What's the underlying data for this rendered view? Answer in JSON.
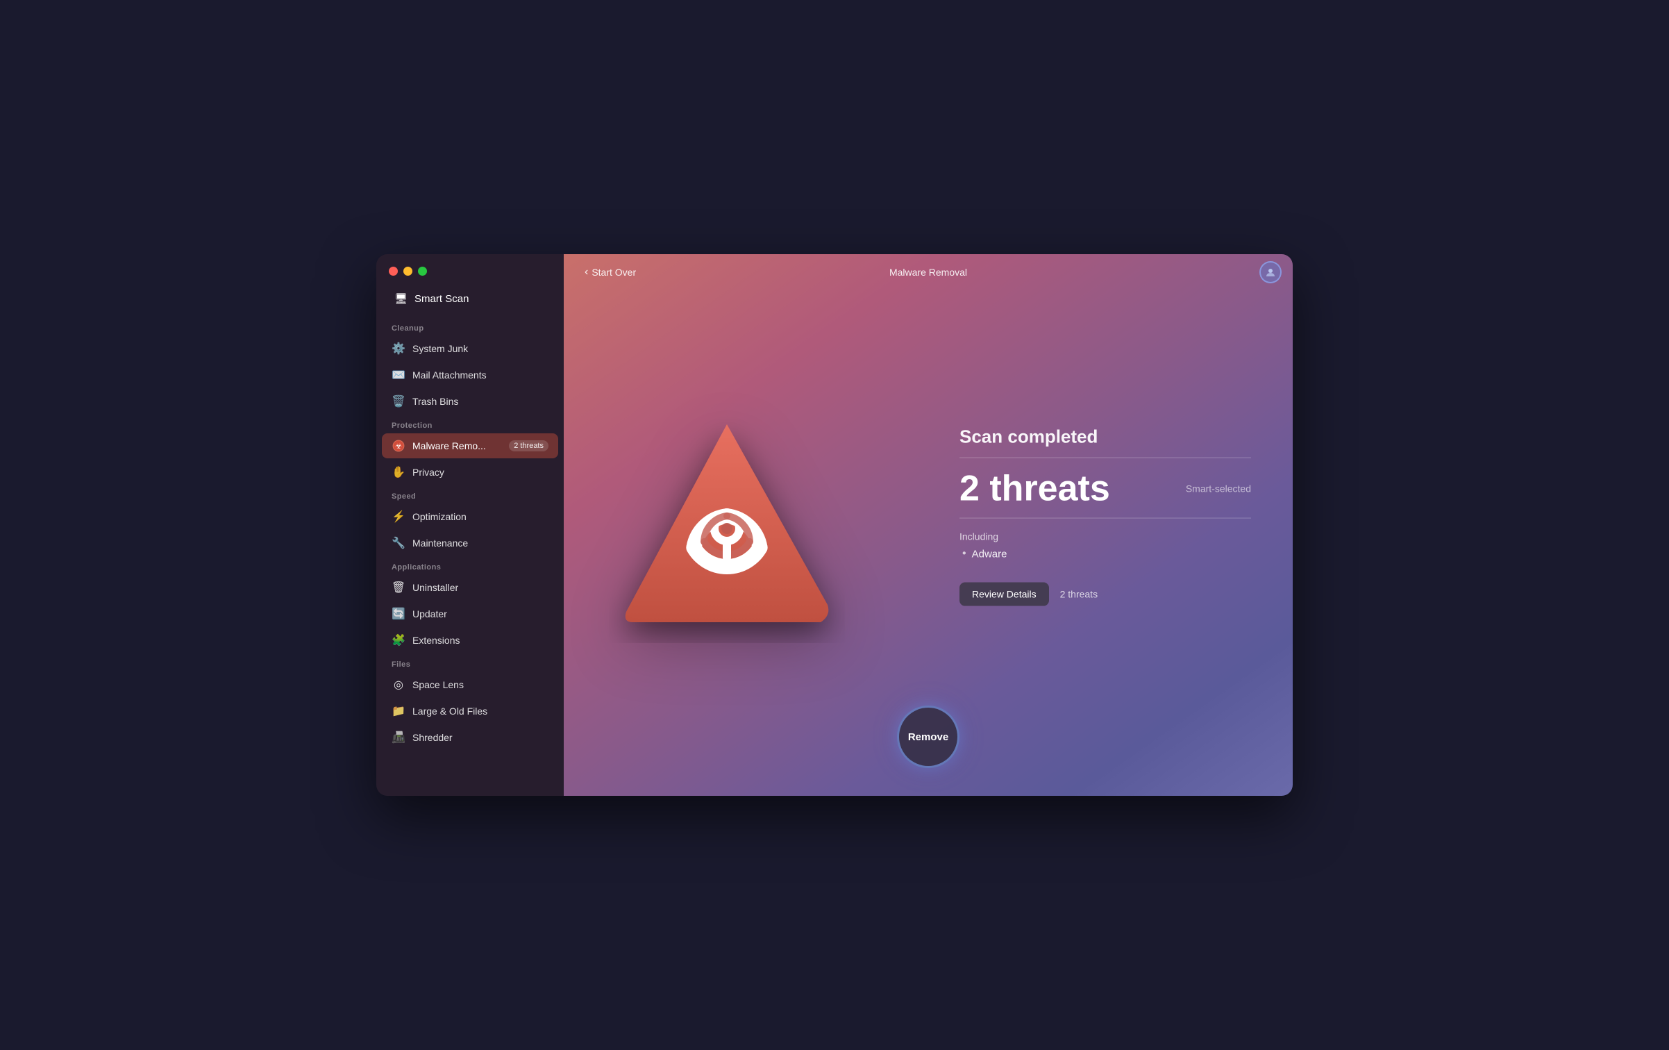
{
  "window": {
    "title": "Malware Removal"
  },
  "traffic_lights": {
    "red": "#ff5f57",
    "yellow": "#febc2e",
    "green": "#28c840"
  },
  "sidebar": {
    "smart_scan_label": "Smart Scan",
    "sections": [
      {
        "label": "Cleanup",
        "items": [
          {
            "id": "system-junk",
            "label": "System Junk",
            "icon": "⚙"
          },
          {
            "id": "mail-attachments",
            "label": "Mail Attachments",
            "icon": "✉"
          },
          {
            "id": "trash-bins",
            "label": "Trash Bins",
            "icon": "🗑"
          }
        ]
      },
      {
        "label": "Protection",
        "items": [
          {
            "id": "malware-removal",
            "label": "Malware Remo...",
            "icon": "☣",
            "active": true,
            "badge": "2 threats"
          },
          {
            "id": "privacy",
            "label": "Privacy",
            "icon": "✋"
          }
        ]
      },
      {
        "label": "Speed",
        "items": [
          {
            "id": "optimization",
            "label": "Optimization",
            "icon": "⚡"
          },
          {
            "id": "maintenance",
            "label": "Maintenance",
            "icon": "🔧"
          }
        ]
      },
      {
        "label": "Applications",
        "items": [
          {
            "id": "uninstaller",
            "label": "Uninstaller",
            "icon": "🗑"
          },
          {
            "id": "updater",
            "label": "Updater",
            "icon": "🔄"
          },
          {
            "id": "extensions",
            "label": "Extensions",
            "icon": "🧩"
          }
        ]
      },
      {
        "label": "Files",
        "items": [
          {
            "id": "space-lens",
            "label": "Space Lens",
            "icon": "◎"
          },
          {
            "id": "large-old-files",
            "label": "Large & Old Files",
            "icon": "📁"
          },
          {
            "id": "shredder",
            "label": "Shredder",
            "icon": "📠"
          }
        ]
      }
    ]
  },
  "header": {
    "back_label": "Start Over",
    "title": "Malware Removal"
  },
  "results": {
    "scan_completed": "Scan completed",
    "threats_count": "2 threats",
    "smart_selected": "Smart-selected",
    "including_label": "Including",
    "threats_list": [
      {
        "name": "Adware"
      }
    ],
    "review_btn_label": "Review Details",
    "review_count": "2 threats"
  },
  "remove_btn": {
    "label": "Remove"
  }
}
